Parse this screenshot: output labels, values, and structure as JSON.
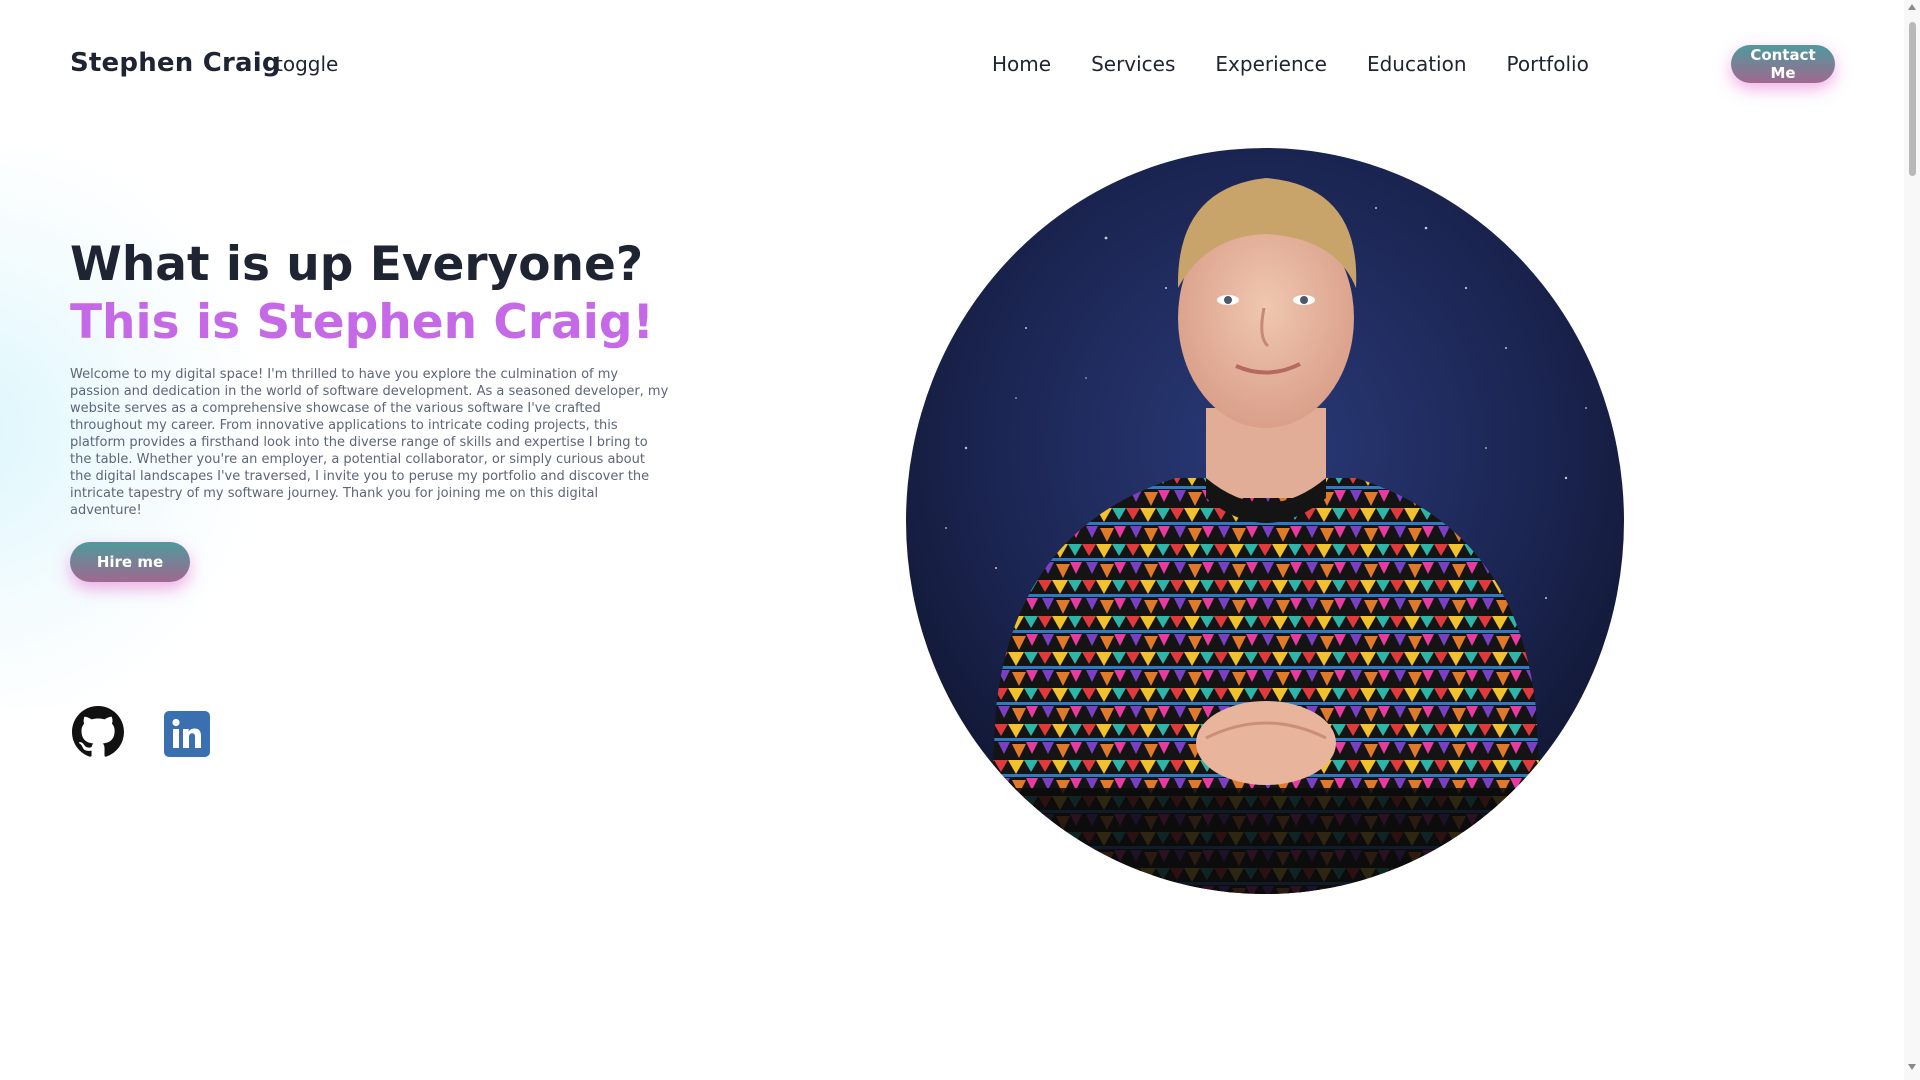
{
  "header": {
    "brand": "Stephen Craig",
    "toggle_label": "toggle",
    "nav": [
      {
        "label": "Home"
      },
      {
        "label": "Services"
      },
      {
        "label": "Experience"
      },
      {
        "label": "Education"
      },
      {
        "label": "Portfolio"
      }
    ],
    "contact_label": "Contact Me"
  },
  "hero": {
    "headline": "What is up Everyone?",
    "subheadline": "This is Stephen Craig!",
    "intro": "Welcome to my digital space! I'm thrilled to have you explore the culmination of my passion and dedication in the world of software development. As a seasoned developer, my website serves as a comprehensive showcase of the various software I've crafted throughout my career. From innovative applications to intricate coding projects, this platform provides a firsthand look into the diverse range of skills and expertise I bring to the table. Whether you're an employer, a potential collaborator, or simply curious about the digital landscapes I've traversed, I invite you to peruse my portfolio and discover the intricate tapestry of my software journey. Thank you for joining me on this digital adventure!",
    "hire_label": "Hire me"
  },
  "social": [
    {
      "icon": "github-icon"
    },
    {
      "icon": "linkedin-icon"
    }
  ],
  "portrait": {
    "description_icon": "profile-photo"
  },
  "colors": {
    "text_dark": "#1f2433",
    "accent_purple": "#c569e6",
    "button_gradient_top": "#4e9a9c",
    "button_gradient_bottom": "#a06890",
    "button_glow": "#e66ed2",
    "linkedin_blue": "#3a6fb0"
  }
}
